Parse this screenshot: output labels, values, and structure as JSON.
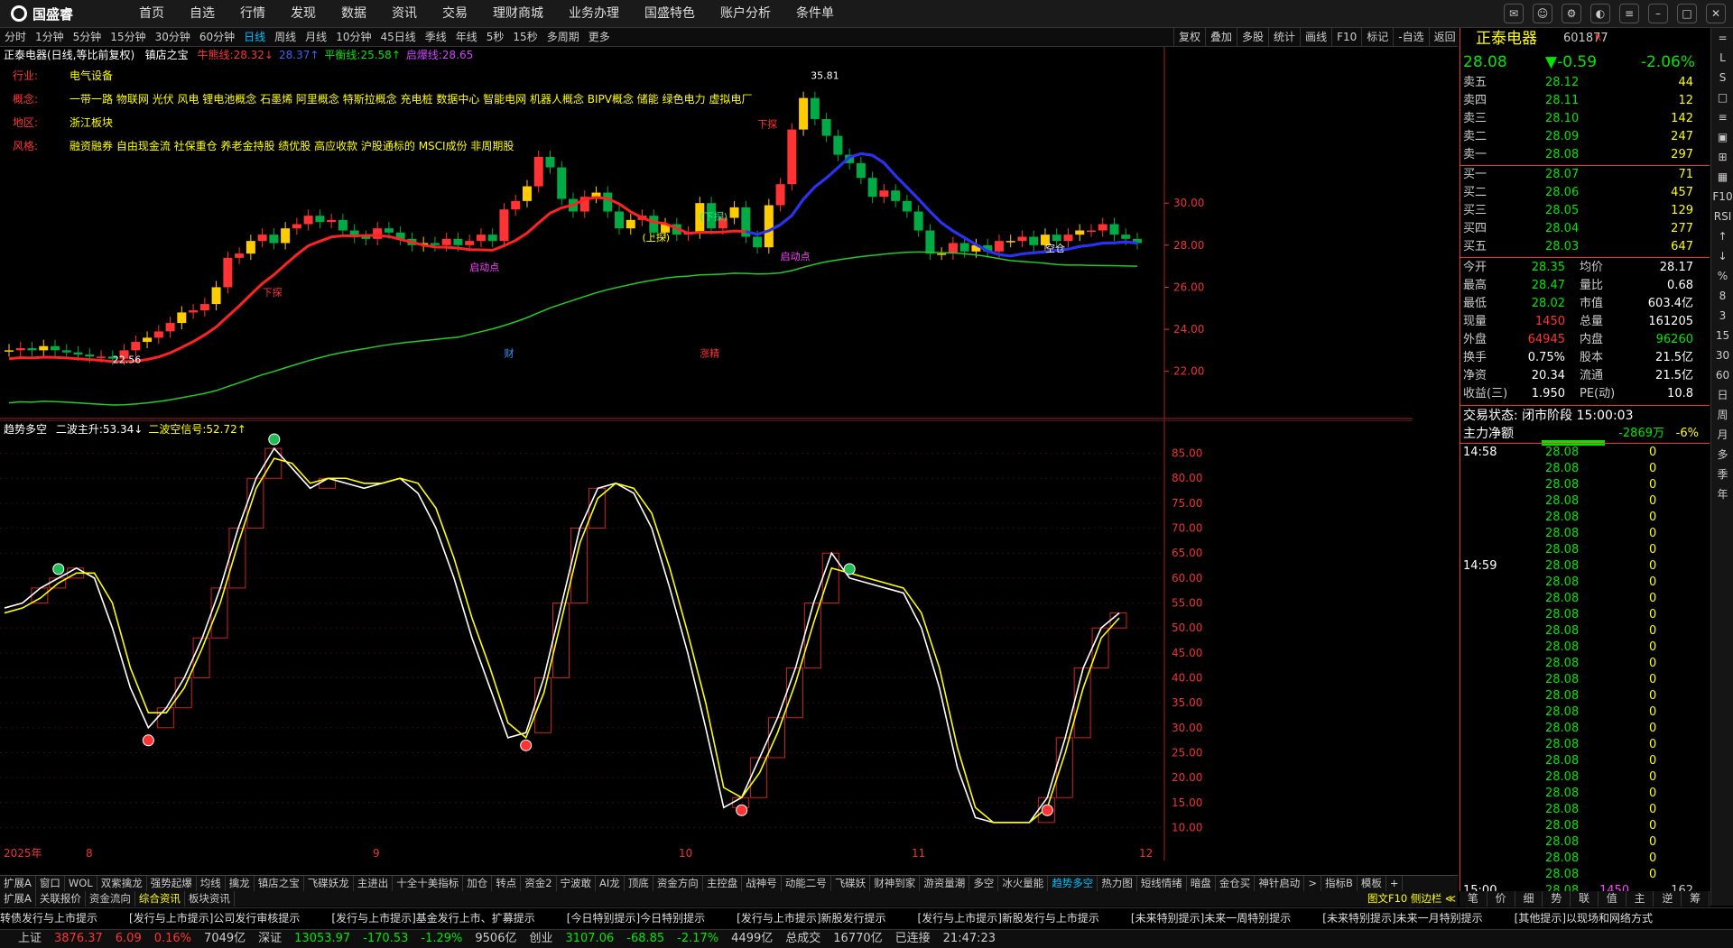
{
  "app": {
    "logo": "国盛睿"
  },
  "menu": [
    "首页",
    "自选",
    "行情",
    "发现",
    "数据",
    "资讯",
    "交易",
    "理财商城",
    "业务办理",
    "国盛特色",
    "账户分析",
    "条件单"
  ],
  "periods": [
    "分时",
    "1分钟",
    "5分钟",
    "15分钟",
    "30分钟",
    "60分钟",
    "日线",
    "周线",
    "月线",
    "10分钟",
    "45日线",
    "季线",
    "年线",
    "5秒",
    "15秒",
    "多周期",
    "更多"
  ],
  "active_period": "日线",
  "toolbar_right": [
    "复权",
    "叠加",
    "多股",
    "统计",
    "画线",
    "F10",
    "标记",
    "-自选",
    "返回"
  ],
  "kline": {
    "title": "正泰电器(日线,等比前复权)",
    "indicator": "镇店之宝",
    "lines": [
      {
        "label": "牛熊线:",
        "value": "28.32",
        "arrow": "↓",
        "color": "#ff3333"
      },
      {
        "label": "",
        "value": "28.37",
        "arrow": "↑",
        "color": "#3366ff"
      },
      {
        "label": "平衡线:",
        "value": "25.58",
        "arrow": "↑",
        "color": "#00e600"
      },
      {
        "label": "启爆线:",
        "value": "28.65",
        "arrow": "",
        "color": "#cc44ff"
      }
    ],
    "info": [
      {
        "k": "行业:",
        "v": "电气设备"
      },
      {
        "k": "概念:",
        "v": "一带一路 物联网 光伏 风电 锂电池概念 石墨烯 阿里概念 特斯拉概念 充电桩 数据中心 智能电网 机器人概念 BIPV概念 储能 绿色电力 虚拟电厂"
      },
      {
        "k": "地区:",
        "v": "浙江板块"
      },
      {
        "k": "风格:",
        "v": "融资融券 自由现金流 社保重仓 养老金持股 绩优股 高应收款 沪股通标的 MSCI成份 非周期股"
      }
    ],
    "yaxis": [
      "28.00",
      "26.00",
      "24.00",
      "22.00",
      "30.00"
    ],
    "yaxis_values": [
      28,
      26,
      24,
      22,
      30
    ],
    "price_marks": {
      "high": "35.81",
      "low": "22.56"
    },
    "labels": [
      "下探",
      "(上探)",
      "(下探)",
      "下探",
      "启动点",
      "启动点",
      "空仓",
      "财",
      "涨精"
    ],
    "chart_data": {
      "type": "candlestick",
      "ylim": [
        21,
        37
      ],
      "close": [
        23.0,
        23.1,
        23.0,
        23.2,
        23.0,
        22.9,
        22.8,
        22.7,
        22.7,
        22.6,
        23.0,
        23.4,
        23.6,
        23.9,
        24.3,
        24.8,
        24.9,
        25.2,
        26.0,
        27.4,
        27.6,
        28.2,
        28.5,
        28.1,
        28.8,
        29.0,
        29.4,
        29.1,
        29.2,
        28.7,
        28.4,
        28.3,
        28.8,
        28.6,
        28.3,
        28.0,
        28.1,
        28.0,
        28.3,
        28.0,
        28.2,
        28.5,
        28.2,
        29.7,
        30.1,
        30.8,
        32.2,
        31.7,
        30.2,
        29.6,
        30.3,
        30.5,
        29.6,
        28.8,
        29.2,
        29.4,
        28.6,
        29.0,
        28.5,
        28.6,
        30.0,
        28.8,
        29.3,
        29.8,
        28.4,
        27.9,
        29.9,
        30.9,
        33.5,
        35.0,
        34.0,
        33.2,
        32.3,
        31.9,
        31.2,
        30.3,
        30.6,
        30.1,
        29.6,
        28.7,
        27.6,
        27.6,
        28.1,
        27.7,
        28.0,
        27.7,
        28.2,
        28.2,
        28.4,
        28.0,
        28.5,
        28.2,
        28.5,
        28.7,
        28.7,
        29.0,
        28.5,
        28.3,
        28.1
      ]
    }
  },
  "indicator": {
    "name": "趋势多空",
    "lines": [
      {
        "label": "二波主升:",
        "value": "53.34",
        "arrow": "↓",
        "color": "#fff"
      },
      {
        "label": "二波空信号:",
        "value": "52.72",
        "arrow": "↑",
        "color": "#ffff00"
      }
    ],
    "yaxis": [
      "85.00",
      "80.00",
      "75.00",
      "70.00",
      "65.00",
      "60.00",
      "55.00",
      "50.00",
      "45.00",
      "40.00",
      "35.00",
      "30.00",
      "25.00",
      "20.00",
      "15.00",
      "10.00"
    ],
    "xaxis": [
      "2025年",
      "8",
      "9",
      "10",
      "11",
      "12"
    ],
    "chart_data": {
      "type": "line",
      "ylim": [
        7,
        88
      ],
      "series": [
        {
          "name": "二波主升",
          "color": "#ffffff",
          "values": [
            54,
            55,
            58,
            60,
            62,
            60,
            50,
            38,
            30,
            34,
            40,
            48,
            58,
            70,
            80,
            86,
            82,
            78,
            80,
            79,
            78,
            79,
            80,
            77,
            70,
            60,
            48,
            38,
            28,
            29,
            40,
            55,
            70,
            78,
            79,
            77,
            70,
            58,
            45,
            30,
            14,
            16,
            24,
            32,
            42,
            55,
            65,
            60,
            59,
            58,
            57,
            50,
            38,
            22,
            12,
            11,
            11,
            11,
            16,
            28,
            42,
            50,
            53
          ]
        },
        {
          "name": "二波空信号",
          "color": "#ffff00",
          "values": [
            53,
            54,
            56,
            59,
            61,
            61,
            55,
            42,
            33,
            33,
            38,
            46,
            55,
            67,
            78,
            84,
            83,
            79,
            80,
            80,
            79,
            79,
            80,
            79,
            74,
            64,
            52,
            42,
            31,
            28,
            37,
            52,
            67,
            76,
            79,
            78,
            73,
            62,
            49,
            35,
            18,
            16,
            21,
            29,
            39,
            51,
            62,
            61,
            60,
            59,
            58,
            53,
            42,
            26,
            14,
            11,
            11,
            11,
            14,
            25,
            38,
            48,
            52
          ]
        }
      ],
      "markers": [
        {
          "i": 3,
          "type": "buy"
        },
        {
          "i": 8,
          "type": "sell"
        },
        {
          "i": 15,
          "type": "buy"
        },
        {
          "i": 29,
          "type": "sell"
        },
        {
          "i": 41,
          "type": "sell"
        },
        {
          "i": 47,
          "type": "buy"
        },
        {
          "i": 58,
          "type": "sell"
        }
      ]
    }
  },
  "tabs1": [
    "扩展A",
    "窗口",
    "WOL",
    "双紫擒龙",
    "强势起爆",
    "均线",
    "擒龙",
    "镇店之宝",
    "飞碟妖龙",
    "主进出",
    "十全十美指标",
    "加仓",
    "转点",
    "资金2",
    "宁波敢",
    "AI龙",
    "顶底",
    "资金方向",
    "主控盘",
    "战神号",
    "动能二号",
    "飞碟妖",
    "财神到家",
    "游资量潮",
    "多空",
    "冰火量能",
    "趋势多空",
    "热力图",
    "短线情绪",
    "暗盘",
    "金仓买",
    "神针启动",
    ">",
    "指标B",
    "模板",
    "+"
  ],
  "tabs1_active": "趋势多空",
  "tabs2": [
    "扩展A",
    "关联报价",
    "资金流向",
    "综合资讯",
    "板块资讯"
  ],
  "tabs2_active": "综合资讯",
  "tabs2_right": "图文F10 侧边栏 ≪",
  "news": [
    "转债发行与上市提示",
    "[发行与上市提示]公司发行审核提示",
    "[发行与上市提示]基金发行上市、扩募提示",
    "[今日特别提示]今日特别提示",
    "[发行与上市提示]新股发行提示",
    "[发行与上市提示]新股发行与上市提示",
    "[未来特别提示]未来一周特别提示",
    "[未来特别提示]未来一月特别提示",
    "[其他提示]以现场和网络方式"
  ],
  "status": [
    {
      "t": "上证",
      "c": "#ccc"
    },
    {
      "t": "3876.37",
      "c": "#ff3333"
    },
    {
      "t": "6.09",
      "c": "#ff3333"
    },
    {
      "t": "0.16%",
      "c": "#ff3333"
    },
    {
      "t": "7049亿",
      "c": "#ccc"
    },
    {
      "t": "深证",
      "c": "#ccc"
    },
    {
      "t": "13053.97",
      "c": "#00e600"
    },
    {
      "t": "-170.53",
      "c": "#00e600"
    },
    {
      "t": "-1.29%",
      "c": "#00e600"
    },
    {
      "t": "9506亿",
      "c": "#ccc"
    },
    {
      "t": "创业",
      "c": "#ccc"
    },
    {
      "t": "3107.06",
      "c": "#00e600"
    },
    {
      "t": "-68.85",
      "c": "#00e600"
    },
    {
      "t": "-2.17%",
      "c": "#00e600"
    },
    {
      "t": "4499亿",
      "c": "#ccc"
    },
    {
      "t": "总成交",
      "c": "#ccc"
    },
    {
      "t": "16770亿",
      "c": "#ccc"
    },
    {
      "t": "已连接",
      "c": "#ccc"
    },
    {
      "t": "21:47:23",
      "c": "#ccc"
    }
  ],
  "quote": {
    "name": "正泰电器",
    "code": "601877",
    "badge": "R",
    "price": "28.08",
    "change": "▼-0.59",
    "pct": "-2.06%",
    "asks": [
      {
        "label": "卖五",
        "price": "28.12",
        "vol": "44"
      },
      {
        "label": "卖四",
        "price": "28.11",
        "vol": "12"
      },
      {
        "label": "卖三",
        "price": "28.10",
        "vol": "142"
      },
      {
        "label": "卖二",
        "price": "28.09",
        "vol": "247"
      },
      {
        "label": "卖一",
        "price": "28.08",
        "vol": "297"
      }
    ],
    "bids": [
      {
        "label": "买一",
        "price": "28.07",
        "vol": "71"
      },
      {
        "label": "买二",
        "price": "28.06",
        "vol": "457"
      },
      {
        "label": "买三",
        "price": "28.05",
        "vol": "129"
      },
      {
        "label": "买四",
        "price": "28.04",
        "vol": "277"
      },
      {
        "label": "买五",
        "price": "28.03",
        "vol": "647"
      }
    ],
    "stats": [
      [
        "今开",
        "28.35",
        "均价",
        "28.17"
      ],
      [
        "最高",
        "28.47",
        "量比",
        "0.68"
      ],
      [
        "最低",
        "28.02",
        "市值",
        "603.4亿"
      ],
      [
        "现量",
        "1450",
        "总量",
        "161205"
      ],
      [
        "外盘",
        "64945",
        "内盘",
        "96260"
      ],
      [
        "换手",
        "0.75%",
        "股本",
        "21.5亿"
      ],
      [
        "净资",
        "20.34",
        "流通",
        "21.5亿"
      ],
      [
        "收益(三)",
        "1.950",
        "PE(动)",
        "10.8"
      ]
    ],
    "trade_state": "交易状态: 闭市阶段 15:00:03",
    "main_net": {
      "label": "主力净额",
      "value": "-2869万",
      "pct": "-6%"
    },
    "tick_times": [
      "14:58",
      "14:59",
      "15:00"
    ],
    "ticks_price": "28.08",
    "last_tick": {
      "vol": "1450",
      "num": "162"
    }
  },
  "rside": [
    "=",
    "L",
    "S",
    "□",
    "≡",
    "▣",
    "⊞",
    "▦",
    "F10",
    "RSI",
    "↑",
    "↓",
    "%",
    "8",
    "3",
    "15",
    "30",
    "60",
    "日",
    "周",
    "月",
    "多",
    "季",
    "年"
  ],
  "rbot": [
    "笔",
    "价",
    "细",
    "势",
    "联",
    "值",
    "主",
    "逆",
    "筹"
  ]
}
